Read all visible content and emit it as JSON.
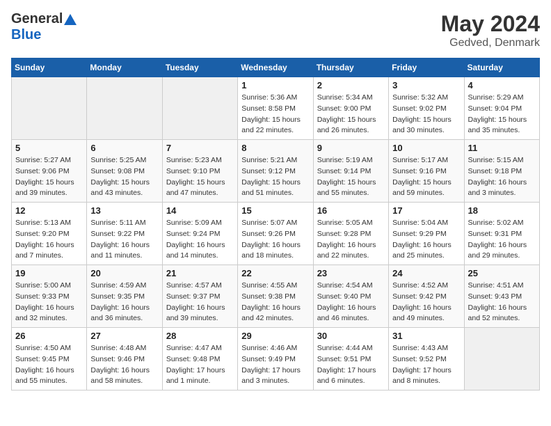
{
  "header": {
    "logo_general": "General",
    "logo_blue": "Blue",
    "title": "May 2024",
    "subtitle": "Gedved, Denmark"
  },
  "days_of_week": [
    "Sunday",
    "Monday",
    "Tuesday",
    "Wednesday",
    "Thursday",
    "Friday",
    "Saturday"
  ],
  "weeks": [
    [
      {
        "day": "",
        "info": ""
      },
      {
        "day": "",
        "info": ""
      },
      {
        "day": "",
        "info": ""
      },
      {
        "day": "1",
        "info": "Sunrise: 5:36 AM\nSunset: 8:58 PM\nDaylight: 15 hours\nand 22 minutes."
      },
      {
        "day": "2",
        "info": "Sunrise: 5:34 AM\nSunset: 9:00 PM\nDaylight: 15 hours\nand 26 minutes."
      },
      {
        "day": "3",
        "info": "Sunrise: 5:32 AM\nSunset: 9:02 PM\nDaylight: 15 hours\nand 30 minutes."
      },
      {
        "day": "4",
        "info": "Sunrise: 5:29 AM\nSunset: 9:04 PM\nDaylight: 15 hours\nand 35 minutes."
      }
    ],
    [
      {
        "day": "5",
        "info": "Sunrise: 5:27 AM\nSunset: 9:06 PM\nDaylight: 15 hours\nand 39 minutes."
      },
      {
        "day": "6",
        "info": "Sunrise: 5:25 AM\nSunset: 9:08 PM\nDaylight: 15 hours\nand 43 minutes."
      },
      {
        "day": "7",
        "info": "Sunrise: 5:23 AM\nSunset: 9:10 PM\nDaylight: 15 hours\nand 47 minutes."
      },
      {
        "day": "8",
        "info": "Sunrise: 5:21 AM\nSunset: 9:12 PM\nDaylight: 15 hours\nand 51 minutes."
      },
      {
        "day": "9",
        "info": "Sunrise: 5:19 AM\nSunset: 9:14 PM\nDaylight: 15 hours\nand 55 minutes."
      },
      {
        "day": "10",
        "info": "Sunrise: 5:17 AM\nSunset: 9:16 PM\nDaylight: 15 hours\nand 59 minutes."
      },
      {
        "day": "11",
        "info": "Sunrise: 5:15 AM\nSunset: 9:18 PM\nDaylight: 16 hours\nand 3 minutes."
      }
    ],
    [
      {
        "day": "12",
        "info": "Sunrise: 5:13 AM\nSunset: 9:20 PM\nDaylight: 16 hours\nand 7 minutes."
      },
      {
        "day": "13",
        "info": "Sunrise: 5:11 AM\nSunset: 9:22 PM\nDaylight: 16 hours\nand 11 minutes."
      },
      {
        "day": "14",
        "info": "Sunrise: 5:09 AM\nSunset: 9:24 PM\nDaylight: 16 hours\nand 14 minutes."
      },
      {
        "day": "15",
        "info": "Sunrise: 5:07 AM\nSunset: 9:26 PM\nDaylight: 16 hours\nand 18 minutes."
      },
      {
        "day": "16",
        "info": "Sunrise: 5:05 AM\nSunset: 9:28 PM\nDaylight: 16 hours\nand 22 minutes."
      },
      {
        "day": "17",
        "info": "Sunrise: 5:04 AM\nSunset: 9:29 PM\nDaylight: 16 hours\nand 25 minutes."
      },
      {
        "day": "18",
        "info": "Sunrise: 5:02 AM\nSunset: 9:31 PM\nDaylight: 16 hours\nand 29 minutes."
      }
    ],
    [
      {
        "day": "19",
        "info": "Sunrise: 5:00 AM\nSunset: 9:33 PM\nDaylight: 16 hours\nand 32 minutes."
      },
      {
        "day": "20",
        "info": "Sunrise: 4:59 AM\nSunset: 9:35 PM\nDaylight: 16 hours\nand 36 minutes."
      },
      {
        "day": "21",
        "info": "Sunrise: 4:57 AM\nSunset: 9:37 PM\nDaylight: 16 hours\nand 39 minutes."
      },
      {
        "day": "22",
        "info": "Sunrise: 4:55 AM\nSunset: 9:38 PM\nDaylight: 16 hours\nand 42 minutes."
      },
      {
        "day": "23",
        "info": "Sunrise: 4:54 AM\nSunset: 9:40 PM\nDaylight: 16 hours\nand 46 minutes."
      },
      {
        "day": "24",
        "info": "Sunrise: 4:52 AM\nSunset: 9:42 PM\nDaylight: 16 hours\nand 49 minutes."
      },
      {
        "day": "25",
        "info": "Sunrise: 4:51 AM\nSunset: 9:43 PM\nDaylight: 16 hours\nand 52 minutes."
      }
    ],
    [
      {
        "day": "26",
        "info": "Sunrise: 4:50 AM\nSunset: 9:45 PM\nDaylight: 16 hours\nand 55 minutes."
      },
      {
        "day": "27",
        "info": "Sunrise: 4:48 AM\nSunset: 9:46 PM\nDaylight: 16 hours\nand 58 minutes."
      },
      {
        "day": "28",
        "info": "Sunrise: 4:47 AM\nSunset: 9:48 PM\nDaylight: 17 hours\nand 1 minute."
      },
      {
        "day": "29",
        "info": "Sunrise: 4:46 AM\nSunset: 9:49 PM\nDaylight: 17 hours\nand 3 minutes."
      },
      {
        "day": "30",
        "info": "Sunrise: 4:44 AM\nSunset: 9:51 PM\nDaylight: 17 hours\nand 6 minutes."
      },
      {
        "day": "31",
        "info": "Sunrise: 4:43 AM\nSunset: 9:52 PM\nDaylight: 17 hours\nand 8 minutes."
      },
      {
        "day": "",
        "info": ""
      }
    ]
  ]
}
